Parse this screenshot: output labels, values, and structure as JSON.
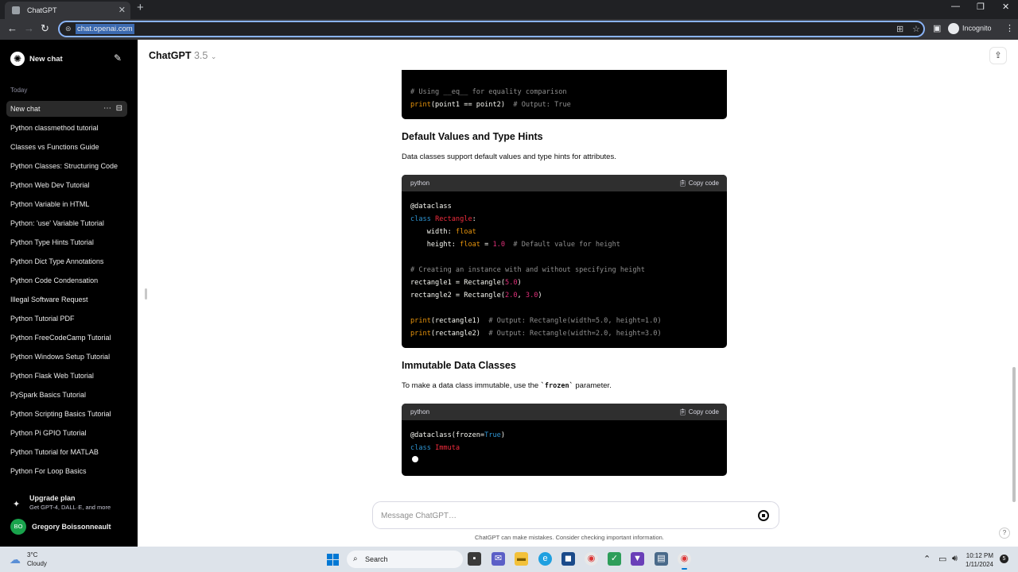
{
  "browser": {
    "tab_title": "ChatGPT",
    "url": "chat.openai.com",
    "profile_label": "Incognito"
  },
  "sidebar": {
    "new_chat_label": "New chat",
    "section_today": "Today",
    "items": [
      {
        "label": "New chat"
      },
      {
        "label": "Python classmethod tutorial"
      },
      {
        "label": "Classes vs Functions Guide"
      },
      {
        "label": "Python Classes: Structuring Code"
      },
      {
        "label": "Python Web Dev Tutorial"
      },
      {
        "label": "Python Variable in HTML"
      },
      {
        "label": "Python: 'use' Variable Tutorial"
      },
      {
        "label": "Python Type Hints Tutorial"
      },
      {
        "label": "Python Dict Type Annotations"
      },
      {
        "label": "Python Code Condensation"
      },
      {
        "label": "Illegal Software Request"
      },
      {
        "label": "Python Tutorial PDF"
      },
      {
        "label": "Python FreeCodeCamp Tutorial"
      },
      {
        "label": "Python Windows Setup Tutorial"
      },
      {
        "label": "Python Flask Web Tutorial"
      },
      {
        "label": "PySpark Basics Tutorial"
      },
      {
        "label": "Python Scripting Basics Tutorial"
      },
      {
        "label": "Python Pi GPIO Tutorial"
      },
      {
        "label": "Python Tutorial for MATLAB"
      },
      {
        "label": "Python For Loop Basics"
      }
    ],
    "upgrade_title": "Upgrade plan",
    "upgrade_subtitle": "Get GPT-4, DALL·E, and more",
    "user_initials": "BO",
    "user_name": "Gregory Boissonneault"
  },
  "header": {
    "model_name": "ChatGPT",
    "model_version": "3.5"
  },
  "content": {
    "block1": {
      "line_comment": "# Using __eq__ for equality comparison",
      "line_print": "print",
      "line_args": "(point1 == point2)",
      "line_output": "# Output: True"
    },
    "section1_heading": "Default Values and Type Hints",
    "section1_text": "Data classes support default values and type hints for attributes.",
    "block2": {
      "language": "python",
      "copy_label": "Copy code"
    },
    "section2_heading": "Immutable Data Classes",
    "section2_text_before": "To make a data class immutable, use the ",
    "section2_code": "`frozen`",
    "section2_text_after": " parameter.",
    "block3": {
      "language": "python",
      "copy_label": "Copy code"
    }
  },
  "composer": {
    "placeholder": "Message ChatGPT…",
    "disclaimer": "ChatGPT can make mistakes. Consider checking important information."
  },
  "taskbar": {
    "weather_temp": "3°C",
    "weather_desc": "Cloudy",
    "search_label": "Search",
    "time": "10:12 PM",
    "date": "1/11/2024",
    "notification_count": "5"
  },
  "colors": {
    "sidebar_bg": "#000000",
    "code_bg": "#000000",
    "code_header_bg": "#2f2f2f",
    "keyword": "#2e95d3",
    "class_name": "#f22c3d",
    "number": "#df3079",
    "type": "#e9950c"
  }
}
